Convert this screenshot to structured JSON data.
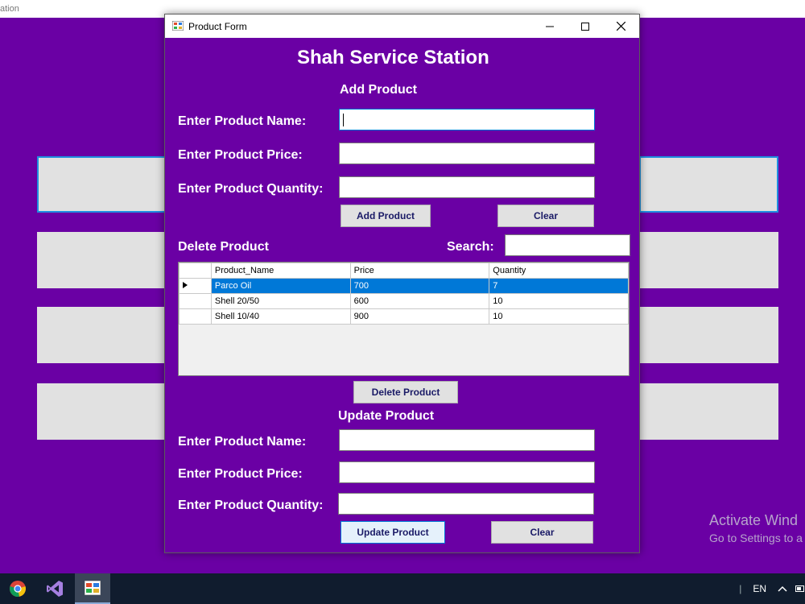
{
  "background_window": {
    "title_fragment": "ation"
  },
  "dialog": {
    "title": "Product Form",
    "heading": "Shah Service Station",
    "add_section": {
      "title": "Add Product",
      "name_label": "Enter Product Name:",
      "price_label": "Enter Product Price:",
      "quantity_label": "Enter Product Quantity:",
      "name_value": "",
      "price_value": "",
      "quantity_value": "",
      "add_button": "Add Product",
      "clear_button": "Clear"
    },
    "delete_section": {
      "title": "Delete Product",
      "search_label": "Search:",
      "search_value": "",
      "table": {
        "columns": [
          "Product_Name",
          "Price",
          "Quantity"
        ],
        "rows": [
          {
            "name": "Parco Oil",
            "price": "700",
            "quantity": "7"
          },
          {
            "name": "Shell 20/50",
            "price": "600",
            "quantity": "10"
          },
          {
            "name": "Shell 10/40",
            "price": "900",
            "quantity": "10"
          }
        ]
      },
      "delete_button": "Delete Product"
    },
    "update_section": {
      "title": "Update Product",
      "name_label": "Enter Product Name:",
      "price_label": "Enter Product Price:",
      "quantity_label": "Enter Product Quantity:",
      "update_button": "Update Product",
      "clear_button": "Clear"
    }
  },
  "watermark": {
    "line1": "Activate Wind",
    "line2": "Go to Settings to a"
  },
  "taskbar": {
    "language": "EN"
  },
  "colors": {
    "form_background": "#6a00a4",
    "selection": "#0078d7",
    "button": "#e1e1e1"
  }
}
